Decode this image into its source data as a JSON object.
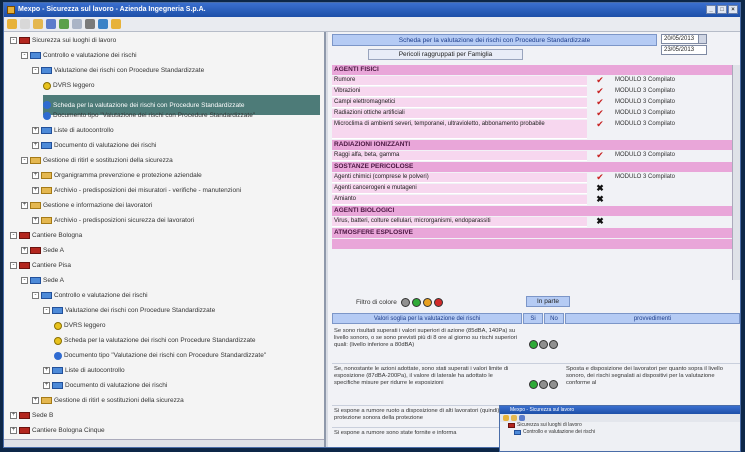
{
  "window": {
    "title": "Mexpo - Sicurezza sul lavoro - Azienda Ingegneria S.p.A.",
    "controls": [
      "_",
      "□",
      "×"
    ]
  },
  "toolbar": {
    "icons": [
      {
        "name": "help-icon",
        "color": "#e7b23a"
      },
      {
        "name": "new-icon",
        "color": "#d8d8d8"
      },
      {
        "name": "open-folder-icon",
        "color": "#e4b750"
      },
      {
        "name": "tools-icon",
        "color": "#5b7ccb"
      },
      {
        "name": "check-icon",
        "color": "#5aa04a"
      },
      {
        "name": "copy-icon",
        "color": "#aab4c6"
      },
      {
        "name": "print-icon",
        "color": "#7a7a7a"
      },
      {
        "name": "export-icon",
        "color": "#3b82c7"
      },
      {
        "name": "search-icon",
        "color": "#e7b23a"
      }
    ]
  },
  "tree": {
    "items": [
      {
        "label": "Sicurezza sui luoghi di lavoro",
        "exp": "-",
        "icon": "fold red"
      },
      {
        "label": "Controllo e valutazione dei rischi",
        "exp": "-",
        "icon": "fold blue"
      },
      {
        "label": "Valutazione dei rischi con Procedure Standardizzate",
        "exp": "-",
        "icon": "fold blue"
      },
      {
        "label": "DVRS leggero",
        "exp": "",
        "icon": "warn"
      },
      {
        "label": "Scheda per la valutazione dei rischi con Procedure Standardizzate",
        "exp": "",
        "icon": "doc",
        "selected": true
      },
      {
        "label": "Documento tipo \"Valutazione dei rischi con Procedure Standardizzate\"",
        "exp": "",
        "icon": "doc"
      },
      {
        "label": "Liste di autocontrollo",
        "exp": "+",
        "icon": "fold blue"
      },
      {
        "label": "Documento di valutazione dei rischi",
        "exp": "+",
        "icon": "fold blue"
      },
      {
        "label": "Gestione di ritirI e sostituzioni della sicurezza",
        "exp": "-",
        "icon": "fold"
      },
      {
        "label": "Organigramma prevenzione e protezione aziendale",
        "exp": "+",
        "icon": "fold"
      },
      {
        "label": "Archivio - predisposizioni dei misuratori - verifiche - manutenzioni",
        "exp": "+",
        "icon": "fold"
      },
      {
        "label": "Gestione e informazione dei lavoratori",
        "exp": "+",
        "icon": "fold"
      },
      {
        "label": "Archivio - predisposizioni sicurezza dei lavoratori",
        "exp": "+",
        "icon": "fold"
      },
      {
        "label": "Cantiere Bologna",
        "exp": "-",
        "icon": "fold red"
      },
      {
        "label": "Sede A",
        "exp": "+",
        "icon": "fold red"
      },
      {
        "label": "Cantiere Pisa",
        "exp": "-",
        "icon": "fold red"
      },
      {
        "label": "Sede A",
        "exp": "-",
        "icon": "fold blue"
      },
      {
        "label": "Controllo e valutazione dei rischi",
        "exp": "-",
        "icon": "fold blue"
      },
      {
        "label": "Valutazione dei rischi con Procedure Standardizzate",
        "exp": "-",
        "icon": "fold blue"
      },
      {
        "label": "DVRS leggero",
        "exp": "",
        "icon": "warn"
      },
      {
        "label": "Scheda per la valutazione dei rischi con Procedure Standardizzate",
        "exp": "",
        "icon": "warn"
      },
      {
        "label": "Documento tipo \"Valutazione dei rischi con Procedure Standardizzate\"",
        "exp": "",
        "icon": "doc"
      },
      {
        "label": "Liste di autocontrollo",
        "exp": "+",
        "icon": "fold blue"
      },
      {
        "label": "Documento di valutazione dei rischi",
        "exp": "+",
        "icon": "fold blue"
      },
      {
        "label": "Gestione di ritirI e sostituzioni della sicurezza",
        "exp": "+",
        "icon": "fold"
      },
      {
        "label": "Sede B",
        "exp": "+",
        "icon": "fold red"
      },
      {
        "label": "Cantiere Bologna Cinque",
        "exp": "+",
        "icon": "fold red"
      }
    ]
  },
  "scheda": {
    "title": "Scheda per la valutazione dei rischi con Procedure Standardizzate",
    "pericoli_button": "Pericoli raggruppati per Famiglia",
    "dates": [
      "20/05/2013",
      "23/05/2013"
    ]
  },
  "risk_table": {
    "rows": [
      {
        "type": "section",
        "label": "AGENTI FISICI"
      },
      {
        "type": "item",
        "label": "Rumore",
        "mark": "ok",
        "module": "MODULO 3 Compilato"
      },
      {
        "type": "item",
        "label": "Vibrazioni",
        "mark": "ok",
        "module": "MODULO 3 Compilato"
      },
      {
        "type": "item",
        "label": "Campi elettromagnetici",
        "mark": "ok",
        "module": "MODULO 3 Compilato"
      },
      {
        "type": "item",
        "label": "Radiazioni ottiche artificiali",
        "mark": "ok",
        "module": "MODULO 3 Compilato"
      },
      {
        "type": "item2",
        "label": "Microclima di ambienti severi, temporanei, ultravioletto, abbonamento probabile",
        "mark": "ok",
        "module": "MODULO 3 Compilato"
      },
      {
        "type": "section",
        "label": "RADIAZIONI IONIZZANTI"
      },
      {
        "type": "item",
        "label": "Raggi alfa, beta, gamma",
        "mark": "ok",
        "module": "MODULO 3 Compilato"
      },
      {
        "type": "section",
        "label": "SOSTANZE PERICOLOSE"
      },
      {
        "type": "item",
        "label": "Agenti chimici (comprese le polveri)",
        "mark": "ok",
        "module": "MODULO 3 Compilato"
      },
      {
        "type": "item",
        "label": "Agenti cancerogeni e mutageni",
        "mark": "no",
        "module": ""
      },
      {
        "type": "item",
        "label": "Amianto",
        "mark": "no",
        "module": ""
      },
      {
        "type": "section",
        "label": "AGENTI BIOLOGICI"
      },
      {
        "type": "item",
        "label": "Virus, batteri, colture cellulari, microrganismi, endoparassiti",
        "mark": "no",
        "module": ""
      },
      {
        "type": "section",
        "label": "ATMOSFERE ESPLOSIVE"
      },
      {
        "type": "section",
        "label": ""
      }
    ]
  },
  "filter": {
    "label": "Filtro di colore",
    "dots": [
      "grey",
      "green",
      "orange",
      "red"
    ],
    "print_button": "In parte"
  },
  "bottom_table": {
    "headers": [
      "Valori soglia per la valutazione dei rischi",
      "Si",
      "No",
      "provvedimenti"
    ],
    "rows": [
      {
        "text": "Se sono risultati superati i valori superiori di azione (85dBA, 140Pa) su livello sonoro, o se sono previsti più di 8 ore al giorno su rischi superiori quali: (livello inferiore a 80dBA)",
        "prov": ""
      },
      {
        "text": "Se, nonostante le azioni adottate, sono stati superati i valori limite di esposizione (87dBA-200Pa), il valore di laterale ha adottato le specifiche misure per ridurre le esposizioni",
        "prov": "Sposta e disposizione dei lavoratori per quanto sopra il livello sonoro, dei rischi segnalati ai dispositivi per la valutazione conforme al"
      },
      {
        "text": "Si espone a rumore ruoto a disposizione di alti lavoratori (quindi) protezione sonora della protezione",
        "prov": ""
      },
      {
        "text": "Si espone a rumore sono state fornite e informa",
        "prov": ""
      }
    ]
  },
  "mini_window": {
    "title": "Mexpo - Sicurezza sul lavoro",
    "rows": [
      "Sicurezza sui luoghi di lavoro",
      "Controllo e valutazione dei rischi"
    ]
  }
}
